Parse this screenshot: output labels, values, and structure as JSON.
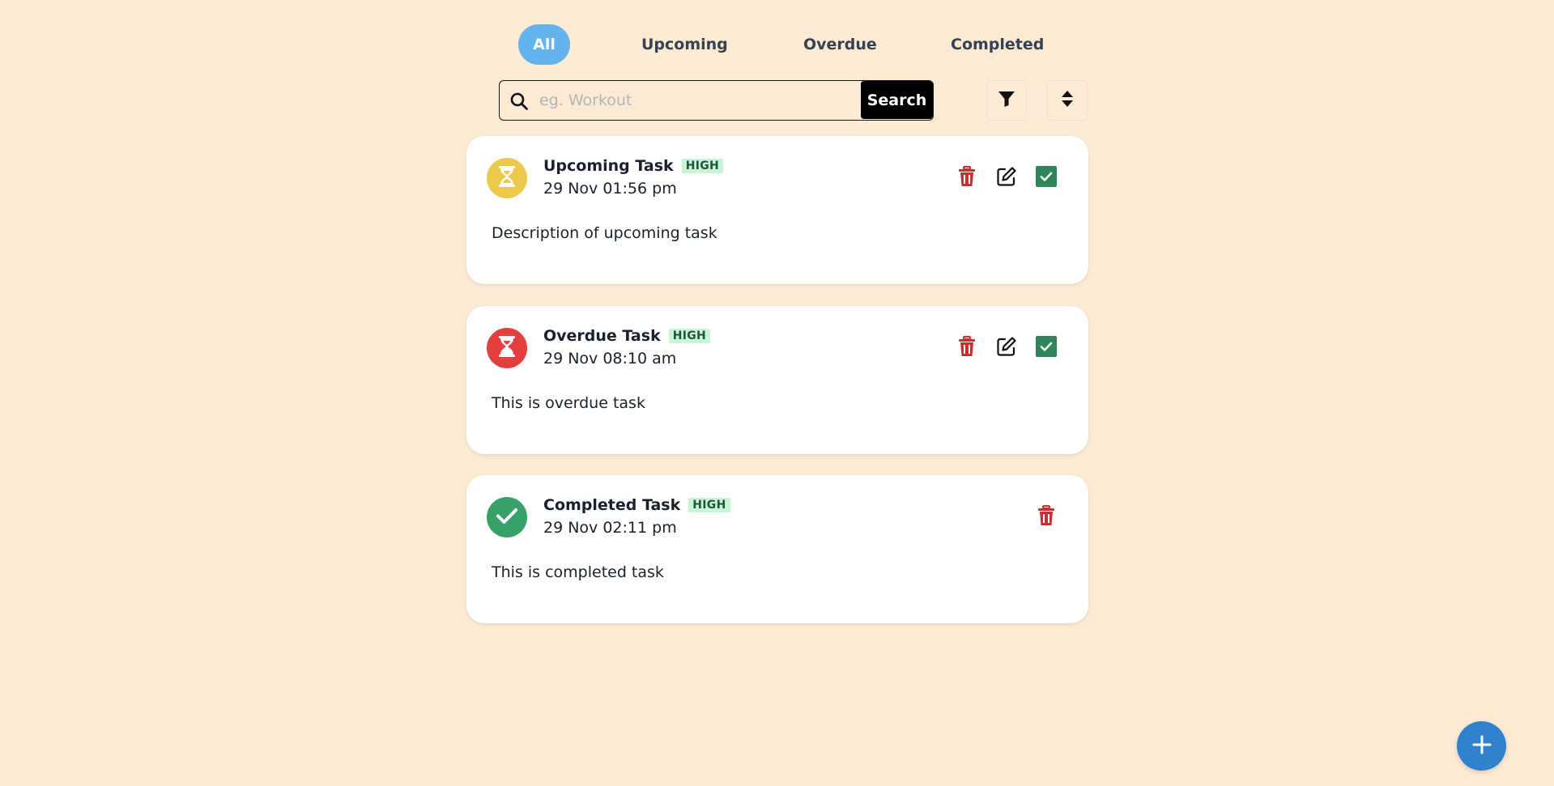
{
  "tabs": [
    {
      "label": "All",
      "active": true
    },
    {
      "label": "Upcoming",
      "active": false
    },
    {
      "label": "Overdue",
      "active": false
    },
    {
      "label": "Completed",
      "active": false
    }
  ],
  "search": {
    "placeholder": "eg. Workout",
    "value": "",
    "button_label": "Search"
  },
  "tasks": [
    {
      "title": "Upcoming Task",
      "priority": "HIGH",
      "date": "29 Nov 01:56 pm",
      "description": "Description of upcoming task",
      "status": "upcoming",
      "status_icon": "hourglass-icon"
    },
    {
      "title": "Overdue Task",
      "priority": "HIGH",
      "date": "29 Nov 08:10 am",
      "description": "This is overdue task",
      "status": "overdue",
      "status_icon": "hourglass-icon"
    },
    {
      "title": "Completed Task",
      "priority": "HIGH",
      "date": "29 Nov 02:11 pm",
      "description": "This is completed task",
      "status": "completed",
      "status_icon": "check-icon"
    }
  ],
  "colors": {
    "background": "#fbebd5",
    "tab_active": "#63b3ed",
    "upcoming": "#ecc94b",
    "overdue": "#e53e3e",
    "completed": "#38a169",
    "complete_checkbox": "#2f855a",
    "delete": "#c53030",
    "fab": "#3182ce",
    "priority_badge_bg": "#c6f6d5",
    "priority_badge_text": "#22543d"
  },
  "icons": {
    "filter": "filter-icon",
    "sort": "sort-icon",
    "search": "search-icon",
    "delete": "trash-icon",
    "edit": "edit-icon",
    "complete": "checkbox-checked-icon",
    "add": "plus-icon"
  }
}
